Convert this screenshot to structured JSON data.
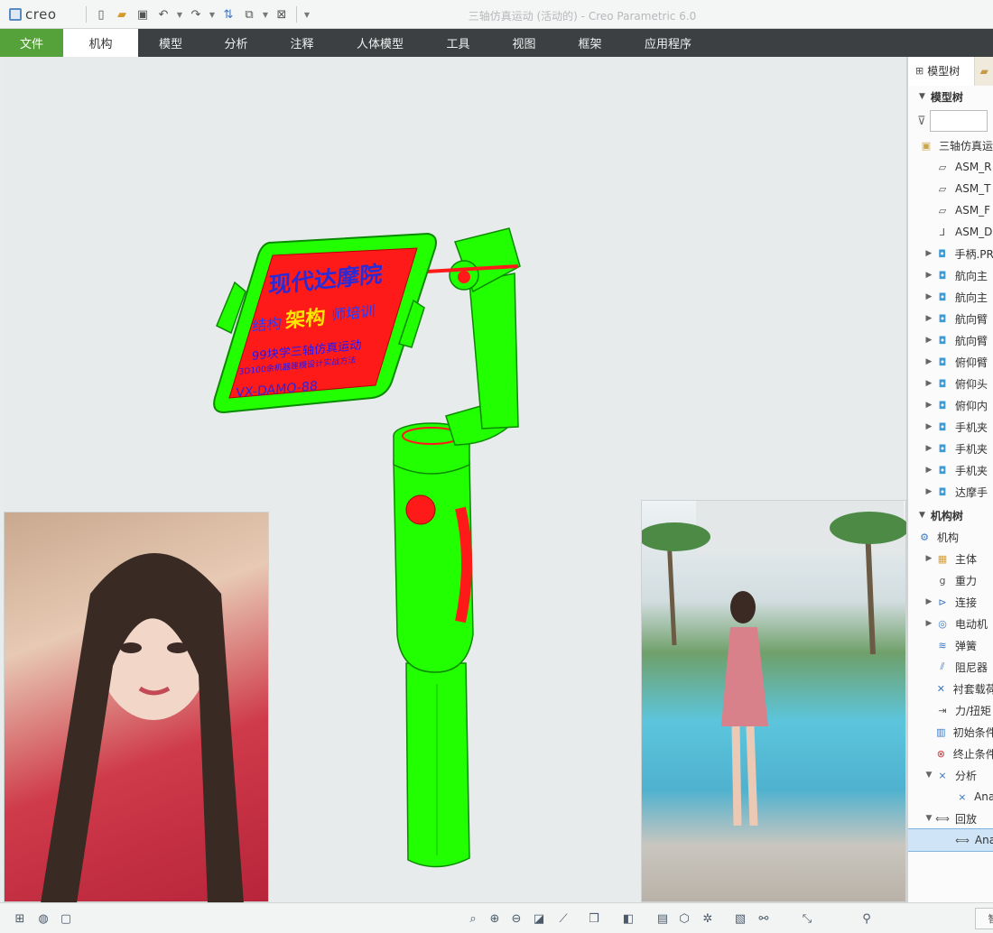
{
  "app": {
    "logo_text": "creo",
    "window_title": "三轴仿真运动 (活动的) - Creo Parametric 6.0"
  },
  "quick_access": [
    "new-icon",
    "open-icon",
    "save-icon",
    "undo-icon",
    "redo-icon",
    "regenerate-icon",
    "windows-icon",
    "close-window-icon"
  ],
  "ribbon": {
    "tabs": [
      "文件",
      "机构",
      "模型",
      "分析",
      "注释",
      "人体模型",
      "工具",
      "视图",
      "框架",
      "应用程序"
    ],
    "active_tab": "机构"
  },
  "model_overlay": {
    "title": "现代达摩院",
    "line2_a": "结构",
    "line2_b": "架构",
    "line2_c": "师培训",
    "line3": "99块学三轴仿真运动",
    "line4": "3D100余机器建模设计实战方法",
    "line5": "VX-DAMO-88",
    "colors": {
      "body": "#22ff00",
      "screen": "#ff1a1a",
      "accent": "#ff0000"
    }
  },
  "panel": {
    "tab_label": "模型树",
    "model_tree_header": "模型树",
    "root": "三轴仿真运",
    "nodes": [
      {
        "label": "ASM_R",
        "icon": "datum-plane-icon",
        "expandable": false
      },
      {
        "label": "ASM_T",
        "icon": "datum-plane-icon",
        "expandable": false
      },
      {
        "label": "ASM_F",
        "icon": "datum-plane-icon",
        "expandable": false
      },
      {
        "label": "ASM_D",
        "icon": "coordinate-system-icon",
        "expandable": false
      },
      {
        "label": "手柄.PR",
        "icon": "part-icon",
        "expandable": true
      },
      {
        "label": "航向主",
        "icon": "part-icon",
        "expandable": true
      },
      {
        "label": "航向主",
        "icon": "part-icon",
        "expandable": true
      },
      {
        "label": "航向臂",
        "icon": "part-icon",
        "expandable": true
      },
      {
        "label": "航向臂",
        "icon": "part-icon",
        "expandable": true
      },
      {
        "label": "俯仰臂",
        "icon": "part-icon",
        "expandable": true
      },
      {
        "label": "俯仰头",
        "icon": "part-icon",
        "expandable": true
      },
      {
        "label": "俯仰内",
        "icon": "part-icon",
        "expandable": true
      },
      {
        "label": "手机夹",
        "icon": "part-icon",
        "expandable": true
      },
      {
        "label": "手机夹",
        "icon": "part-icon",
        "expandable": true
      },
      {
        "label": "手机夹",
        "icon": "part-icon",
        "expandable": true
      },
      {
        "label": "达摩手",
        "icon": "part-icon",
        "expandable": true
      }
    ],
    "mech_tree_header": "机构树",
    "mech_root": "机构",
    "mech_nodes": [
      {
        "label": "主体",
        "icon": "bodies-icon",
        "expandable": true,
        "indent": 1
      },
      {
        "label": "重力",
        "icon": "gravity-icon",
        "expandable": false,
        "indent": 1
      },
      {
        "label": "连接",
        "icon": "connection-icon",
        "expandable": true,
        "indent": 1
      },
      {
        "label": "电动机",
        "icon": "motor-icon",
        "expandable": true,
        "indent": 1
      },
      {
        "label": "弹簧",
        "icon": "spring-icon",
        "expandable": false,
        "indent": 1
      },
      {
        "label": "阻尼器",
        "icon": "damper-icon",
        "expandable": false,
        "indent": 1
      },
      {
        "label": "衬套载荷",
        "icon": "bushing-icon",
        "expandable": false,
        "indent": 1
      },
      {
        "label": "力/扭矩",
        "icon": "force-icon",
        "expandable": false,
        "indent": 1
      },
      {
        "label": "初始条件",
        "icon": "initial-condition-icon",
        "expandable": false,
        "indent": 1
      },
      {
        "label": "终止条件",
        "icon": "termination-icon",
        "expandable": false,
        "indent": 1
      },
      {
        "label": "分析",
        "icon": "analysis-icon",
        "expandable": true,
        "expanded": true,
        "indent": 1
      },
      {
        "label": "Ana",
        "icon": "analysis-icon",
        "expandable": false,
        "indent": 2
      },
      {
        "label": "回放",
        "icon": "playback-icon",
        "expandable": true,
        "expanded": true,
        "indent": 1
      },
      {
        "label": "Ana",
        "icon": "playback-icon",
        "expandable": false,
        "indent": 2,
        "selected": true
      }
    ]
  },
  "status_bar": {
    "left_icons": [
      "tree-toggle-icon",
      "browser-icon",
      "fullscreen-icon"
    ],
    "view_icons": [
      "refit-icon",
      "zoom-in-icon",
      "zoom-out-icon",
      "repaint-icon",
      "perspective-icon",
      "saved-orientations-icon",
      "display-style-icon",
      "view-manager-icon",
      "datum-display-icon",
      "spin-center-icon",
      "annotation-display-icon",
      "mechanism-display-icon"
    ],
    "right_icons": [
      "find-icon"
    ],
    "filter_label": "智"
  }
}
